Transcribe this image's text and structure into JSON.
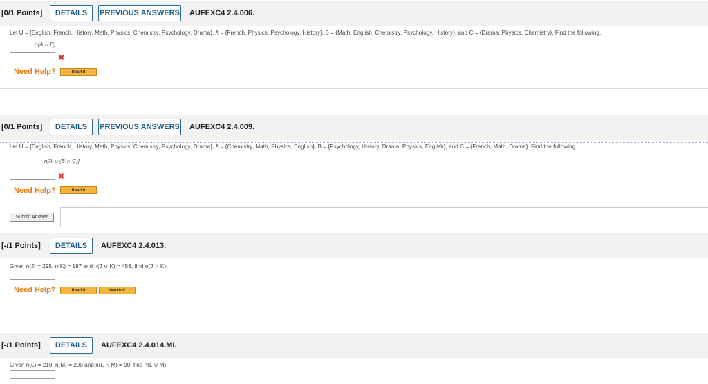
{
  "q1": {
    "points": "[0/1 Points]",
    "details": "DETAILS",
    "previous": "PREVIOUS ANSWERS",
    "code": "AUFEXC4 2.4.006.",
    "prompt": "Let U = {English, French, History, Math, Physics, Chemistry, Psychology, Drama}, A = {French, Physics, Psychology, History}, B = {Math, English, Chemistry, Psychology, History}, and C = {Drama, Physics, Chemistry}. Find the following.",
    "expr": "n(A ∩ B)",
    "need_help": "Need Help?",
    "read_it": "Read It"
  },
  "q2": {
    "points": "[0/1 Points]",
    "details": "DETAILS",
    "previous": "PREVIOUS ANSWERS",
    "code": "AUFEXC4 2.4.009.",
    "prompt": "Let U = {English, French, History, Math, Physics, Chemistry, Psychology, Drama}, A = {Chemistry, Math, Physics, English}, B = {Psychology, History, Drama, Physics, English}, and C = {French, Math, Drama}. Find the following.",
    "expr": "n[A ∪ (B ∩ C)]",
    "need_help": "Need Help?",
    "read_it": "Read It",
    "submit": "Submit Answer"
  },
  "q3": {
    "points": "[-/1 Points]",
    "details": "DETAILS",
    "code": "AUFEXC4 2.4.013.",
    "prompt": "Given n(J) = 295, n(K) = 197 and n(J ∪ K) = 456, find n(J ∩ K).",
    "need_help": "Need Help?",
    "read_it": "Read It",
    "watch_it": "Watch It"
  },
  "q4": {
    "points": "[-/1 Points]",
    "details": "DETAILS",
    "code": "AUFEXC4 2.4.014.MI.",
    "prompt": "Given n(L) = 210, n(M) = 290 and n(L ∩ M) = 90, find n(L ∪ M)."
  }
}
